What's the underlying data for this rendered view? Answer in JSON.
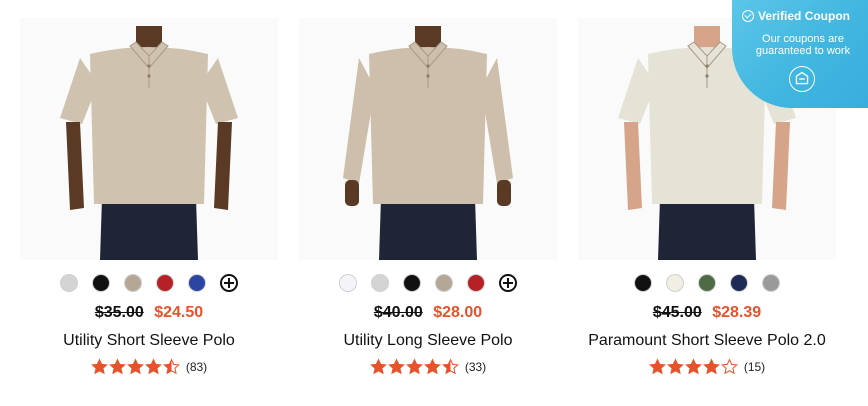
{
  "products": [
    {
      "name": "Utility Short Sleeve Polo",
      "old_price": "$35.00",
      "sale_price": "$24.50",
      "rating": 4.5,
      "review_count": "(83)",
      "swatches": [
        "#d4d4d4",
        "#111111",
        "#b5a795",
        "#b52126",
        "#2b45a0"
      ],
      "has_more_colors": true,
      "image": {
        "sleeve": "short",
        "shirt_color": "#cfc2ae",
        "skin": "#5a3a24"
      }
    },
    {
      "name": "Utility Long Sleeve Polo",
      "old_price": "$40.00",
      "sale_price": "$28.00",
      "rating": 4.5,
      "review_count": "(33)",
      "swatches": [
        "#f4f4f8",
        "#d4d4d4",
        "#111111",
        "#b5a795",
        "#b52126"
      ],
      "has_more_colors": true,
      "image": {
        "sleeve": "long",
        "shirt_color": "#cdbfab",
        "skin": "#5a3a24"
      }
    },
    {
      "name": "Paramount Short Sleeve Polo 2.0",
      "old_price": "$45.00",
      "sale_price": "$28.39",
      "rating": 4.0,
      "review_count": "(15)",
      "swatches": [
        "#111111",
        "#f1efe3",
        "#4e6b45",
        "#1d2b55",
        "#9a9a9a"
      ],
      "has_more_colors": false,
      "image": {
        "sleeve": "short-fitted",
        "shirt_color": "#e5e2d6",
        "skin": "#d6a489"
      }
    }
  ],
  "coupon": {
    "title": "Verified Coupon",
    "subtitle": "Our coupons are guaranteed to work"
  },
  "colors": {
    "sale": "#e8522a",
    "star": "#e8522a",
    "coupon_bg": "#41b8e0"
  }
}
